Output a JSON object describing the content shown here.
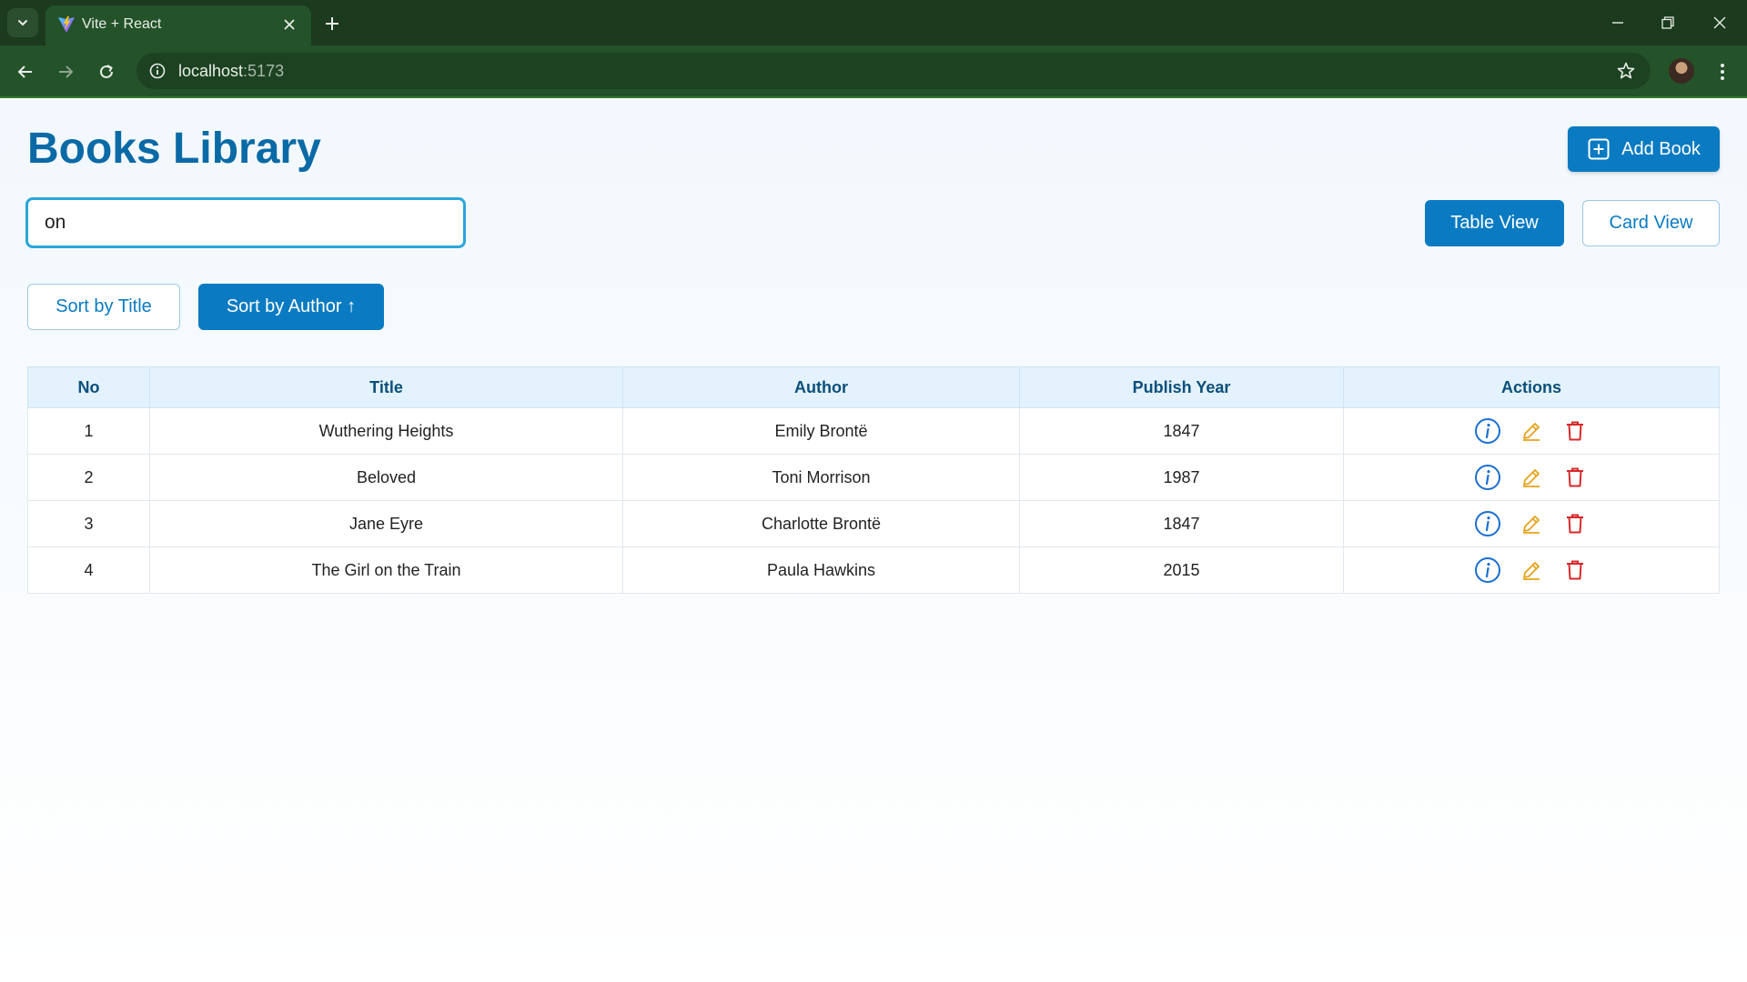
{
  "browser": {
    "tab_title": "Vite + React",
    "url_host": "localhost",
    "url_port": ":5173"
  },
  "app": {
    "title": "Books Library",
    "add_button_label": "Add Book",
    "search_value": "on",
    "view_buttons": {
      "table": "Table View",
      "card": "Card View"
    },
    "sort_buttons": {
      "title": "Sort by Title",
      "author": "Sort by Author ↑"
    },
    "active_view": "table",
    "active_sort": "author"
  },
  "table": {
    "headers": [
      "No",
      "Title",
      "Author",
      "Publish Year",
      "Actions"
    ],
    "rows": [
      {
        "no": "1",
        "title": "Wuthering Heights",
        "author": "Emily Brontë",
        "year": "1847"
      },
      {
        "no": "2",
        "title": "Beloved",
        "author": "Toni Morrison",
        "year": "1987"
      },
      {
        "no": "3",
        "title": "Jane Eyre",
        "author": "Charlotte Brontë",
        "year": "1847"
      },
      {
        "no": "4",
        "title": "The Girl on the Train",
        "author": "Paula Hawkins",
        "year": "2015"
      }
    ],
    "action_icons": [
      "info-icon",
      "edit-icon",
      "delete-icon"
    ]
  },
  "colors": {
    "brand": "#0a7bc2",
    "title": "#0a6aa6",
    "info": "#1a6fd1",
    "edit": "#e5a21a",
    "delete": "#d62828",
    "chrome": "#245229"
  }
}
